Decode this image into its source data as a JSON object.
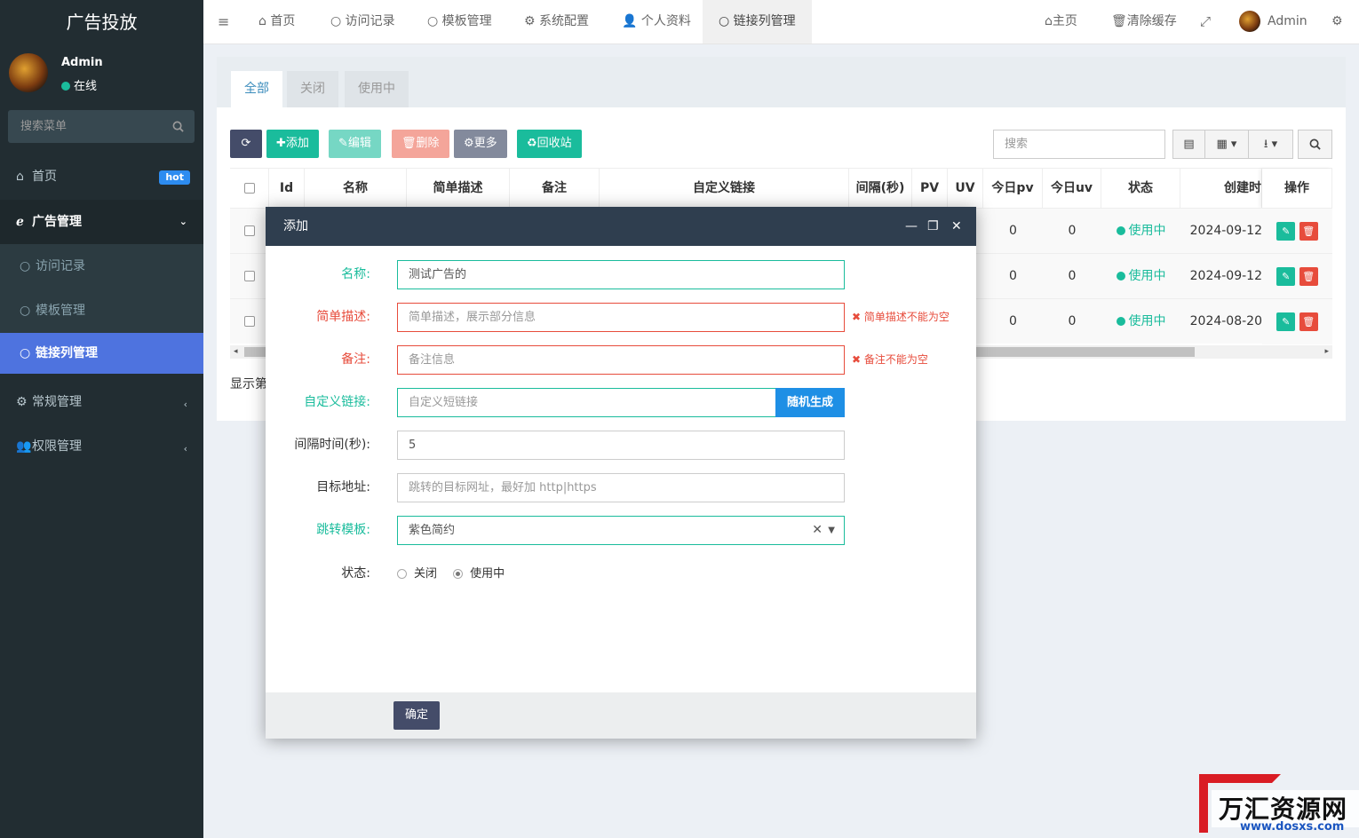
{
  "sidebar": {
    "title": "广告投放",
    "user": {
      "name": "Admin",
      "status": "在线"
    },
    "search_placeholder": "搜索菜单",
    "items": [
      {
        "label": "首页",
        "badge": "hot",
        "icon": "home-icon"
      },
      {
        "label": "广告管理",
        "icon": "ie-icon",
        "expanded": true
      },
      {
        "label": "访问记录",
        "icon": "circle-icon"
      },
      {
        "label": "模板管理",
        "icon": "circle-icon"
      },
      {
        "label": "链接列管理",
        "icon": "circle-icon",
        "current": true
      },
      {
        "label": "常规管理",
        "icon": "cogs-icon"
      },
      {
        "label": "权限管理",
        "icon": "users-icon"
      }
    ]
  },
  "topbar": {
    "tabs": [
      "首页",
      "访问记录",
      "模板管理",
      "系统配置",
      "个人资料",
      "链接列管理"
    ],
    "right": {
      "home": "主页",
      "clear_cache": "清除缓存",
      "user": "Admin"
    }
  },
  "content": {
    "tabs": [
      "全部",
      "关闭",
      "使用中"
    ],
    "toolbar": {
      "add": "添加",
      "edit": "编辑",
      "delete": "删除",
      "more": "更多",
      "recycle": "回收站",
      "search_placeholder": "搜索"
    },
    "table": {
      "headers": [
        "Id",
        "名称",
        "简单描述",
        "备注",
        "自定义链接",
        "间隔(秒)",
        "PV",
        "UV",
        "今日pv",
        "今日uv",
        "状态",
        "创建时",
        "操作"
      ],
      "rows": [
        {
          "today_pv": "0",
          "today_uv": "0",
          "status": "使用中",
          "created": "2024-09-12"
        },
        {
          "today_pv": "0",
          "today_uv": "0",
          "status": "使用中",
          "created": "2024-09-12"
        },
        {
          "today_pv": "0",
          "today_uv": "0",
          "status": "使用中",
          "created": "2024-08-20"
        }
      ]
    },
    "page_info": "显示第"
  },
  "modal": {
    "title": "添加",
    "fields": {
      "name": {
        "label": "名称:",
        "value": "测试广告的"
      },
      "desc": {
        "label": "简单描述:",
        "placeholder": "简单描述，展示部分信息",
        "error": "简单描述不能为空"
      },
      "remark": {
        "label": "备注:",
        "placeholder": "备注信息",
        "error": "备注不能为空"
      },
      "custom_link": {
        "label": "自定义链接:",
        "placeholder": "自定义短链接",
        "button": "随机生成"
      },
      "interval": {
        "label": "间隔时间(秒):",
        "value": "5"
      },
      "target": {
        "label": "目标地址:",
        "placeholder": "跳转的目标网址，最好加 http|https"
      },
      "template": {
        "label": "跳转模板:",
        "value": "紫色简约"
      },
      "status": {
        "label": "状态:",
        "options": [
          "关闭",
          "使用中"
        ],
        "selected": "使用中"
      }
    },
    "confirm": "确定"
  },
  "watermark": {
    "text": "万汇资源网",
    "url": "www.dosxs.com"
  },
  "colors": {
    "accent": "#1abc9c",
    "error": "#e74c3c",
    "sidebar": "#222d32",
    "current_menu": "#4e73df",
    "modal_header": "#2f3e4f"
  }
}
